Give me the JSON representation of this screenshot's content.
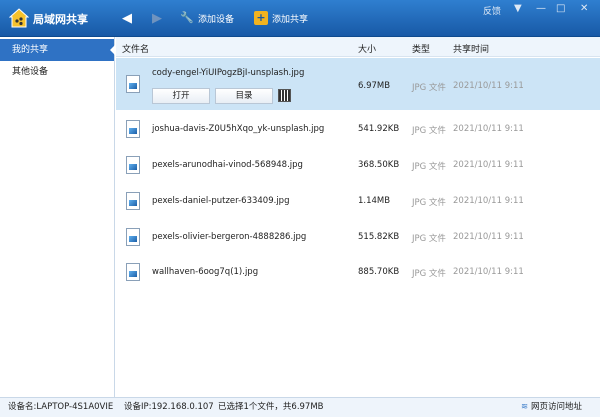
{
  "app": {
    "title": "局域网共享",
    "feedback": "反馈"
  },
  "toolbar": {
    "add_device": "添加设备",
    "add_share": "添加共享"
  },
  "sidebar": {
    "items": [
      {
        "label": "我的共享",
        "active": true
      },
      {
        "label": "其他设备"
      }
    ]
  },
  "table": {
    "headers": {
      "name": "文件名",
      "size": "大小",
      "type": "类型",
      "time": "共享时间"
    },
    "rows": [
      {
        "name": "cody-engel-YiUIPogzBjI-unsplash.jpg",
        "size": "6.97MB",
        "type": "JPG 文件",
        "time": "2021/10/11 9:11"
      },
      {
        "name": "joshua-davis-Z0U5hXqo_yk-unsplash.jpg",
        "size": "541.92KB",
        "type": "JPG 文件",
        "time": "2021/10/11 9:11"
      },
      {
        "name": "pexels-arunodhai-vinod-568948.jpg",
        "size": "368.50KB",
        "type": "JPG 文件",
        "time": "2021/10/11 9:11"
      },
      {
        "name": "pexels-daniel-putzer-633409.jpg",
        "size": "1.14MB",
        "type": "JPG 文件",
        "time": "2021/10/11 9:11"
      },
      {
        "name": "pexels-olivier-bergeron-4888286.jpg",
        "size": "515.82KB",
        "type": "JPG 文件",
        "time": "2021/10/11 9:11"
      },
      {
        "name": "wallhaven-6oog7q(1).jpg",
        "size": "885.70KB",
        "type": "JPG 文件",
        "time": "2021/10/11 9:11"
      }
    ],
    "open_label": "打开",
    "folder_label": "目录"
  },
  "status": {
    "device_name": "设备名:LAPTOP-4S1A0VIE",
    "device_ip": "设备IP:192.168.0.107",
    "selection": "已选择1个文件，共6.97MB",
    "web_access": "网页访问地址"
  },
  "colors": {
    "titlebar": "#1859a6",
    "selected_row": "#cce4f6",
    "sidebar_active": "#2f72c4"
  }
}
